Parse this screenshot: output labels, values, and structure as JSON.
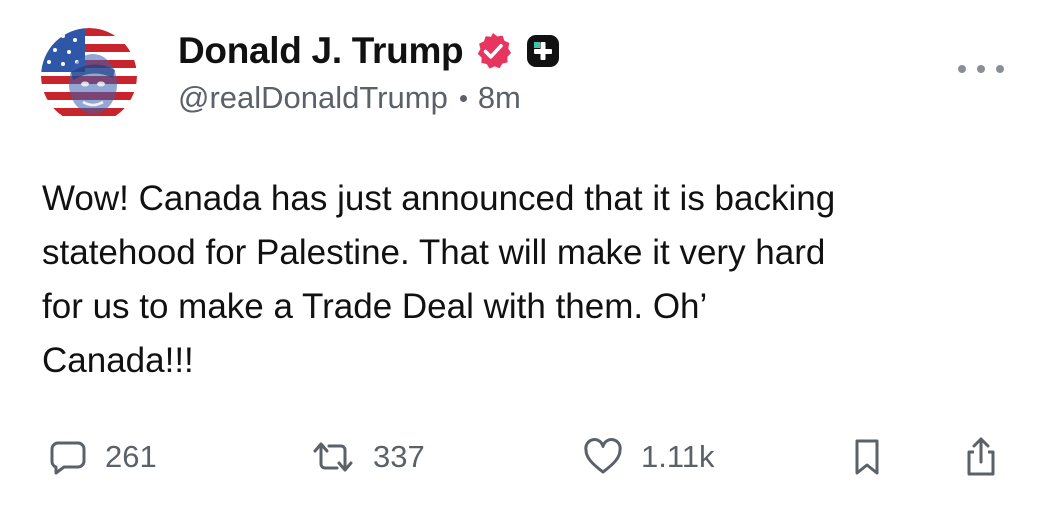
{
  "author": {
    "display_name": "Donald J. Trump",
    "handle": "@realDonaldTrump",
    "time_ago": "8m",
    "avatar": "avatar-flag-portrait",
    "verified_icon": "verified-badge-icon",
    "plus_icon": "plus-badge-icon"
  },
  "post": {
    "text": "Wow! Canada has just announced that it is backing\nstatehood for Palestine. That will make it very hard\nfor us to make a Trade Deal with them. Oh’\nCanada!!!"
  },
  "actions": {
    "reply_count": "261",
    "repost_count": "337",
    "like_count": "1.11k",
    "reply_icon": "comment-bubble-icon",
    "repost_icon": "repost-arrows-icon",
    "like_icon": "heart-icon",
    "bookmark_icon": "bookmark-icon",
    "share_icon": "share-upload-icon",
    "more_icon": "more-dots-icon"
  },
  "colors": {
    "text": "#111111",
    "muted": "#5b6169",
    "verified": "#e8355f",
    "badge_dark": "#111111"
  }
}
